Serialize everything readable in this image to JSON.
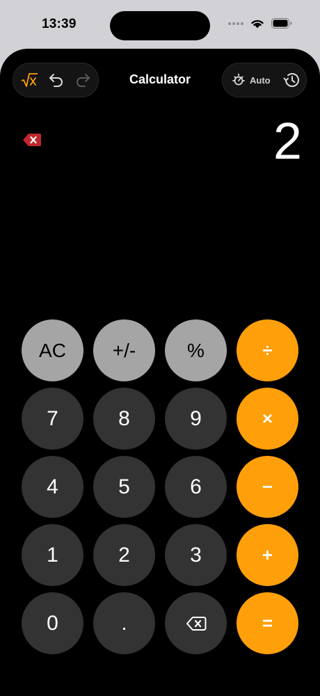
{
  "status": {
    "time": "13:39"
  },
  "header": {
    "title": "Calculator",
    "auto_label": "Auto"
  },
  "display": {
    "value": "2"
  },
  "keys": {
    "ac": "AC",
    "sign": "+/-",
    "percent": "%",
    "divide": "÷",
    "seven": "7",
    "eight": "8",
    "nine": "9",
    "multiply": "×",
    "four": "4",
    "five": "5",
    "six": "6",
    "minus": "−",
    "one": "1",
    "two": "2",
    "three": "3",
    "plus": "+",
    "zero": "0",
    "decimal": ".",
    "equals": "="
  },
  "icons": {
    "sqrt": "sqrt-icon",
    "undo": "undo-icon",
    "redo": "redo-icon",
    "theme": "brightness-icon",
    "history": "history-icon",
    "clear": "clear-display-icon",
    "backspace": "backspace-icon"
  },
  "colors": {
    "accent": "#ff9f0a",
    "function_key": "#a5a5a5",
    "number_key": "#333333",
    "delete_red": "#c0262d",
    "background": "#000000"
  }
}
